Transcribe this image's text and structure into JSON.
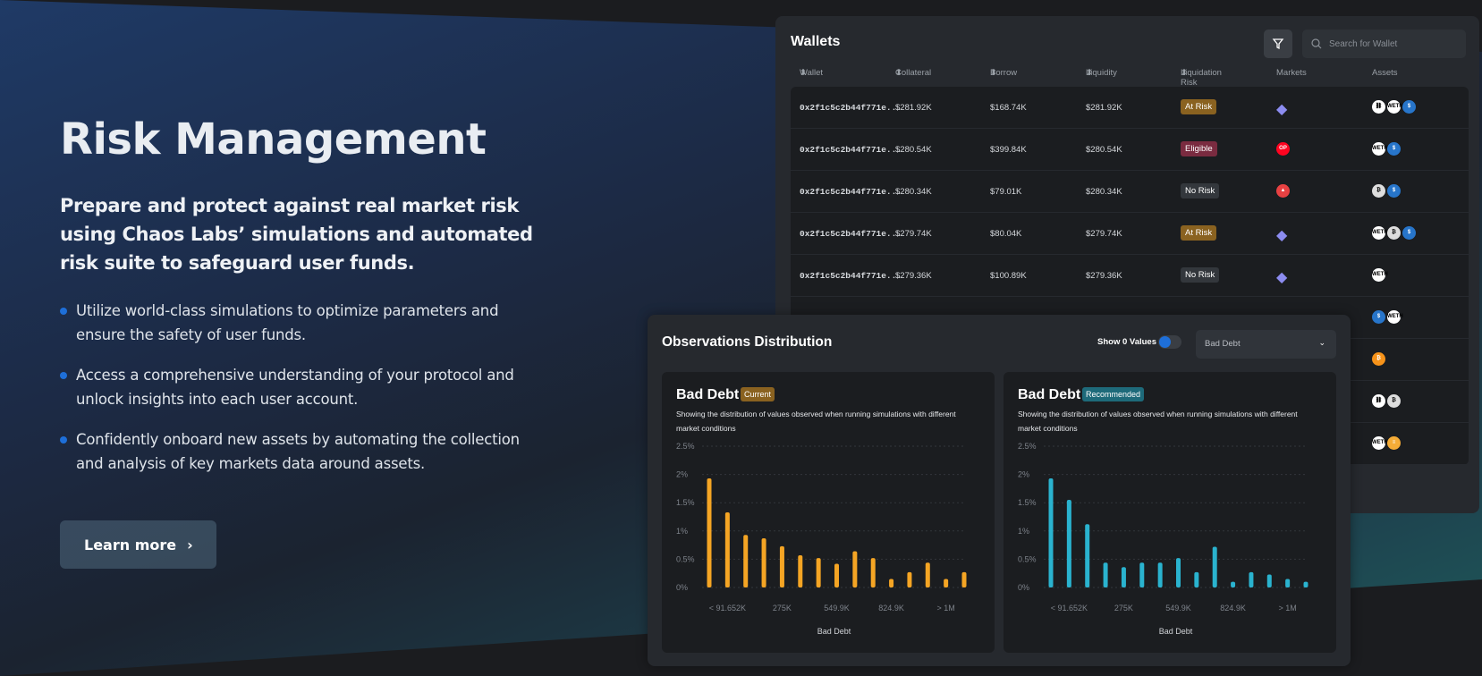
{
  "hero": {
    "title": "Risk Management",
    "lead": "Prepare and protect against real market risk using Chaos Labs’ simulations and automated risk suite to safeguard user funds.",
    "bullets": [
      "Utilize world-class simulations to optimize parameters and ensure the safety of user funds.",
      "Access a comprehensive understanding of your protocol and unlock insights into each user account.",
      "Confidently onboard new assets by automating the collection and analysis of key markets data around assets."
    ],
    "cta": "Learn more"
  },
  "wallets": {
    "title": "Wallets",
    "search_placeholder": "Search for Wallet",
    "columns": [
      "Wallet",
      "Collateral",
      "Borrow",
      "Liquidity",
      "Liquidation Risk",
      "Markets",
      "Assets"
    ],
    "rows": [
      {
        "wallet": "0x2f1c5c2b44f771e...",
        "collateral": "$281.92K",
        "borrow": "$168.74K",
        "liquidity": "$281.92K",
        "risk": "At Risk",
        "market": "ethereum",
        "assets": [
          "link",
          "weth",
          "usdc"
        ]
      },
      {
        "wallet": "0x2f1c5c2b44f771e...",
        "collateral": "$280.54K",
        "borrow": "$399.84K",
        "liquidity": "$280.54K",
        "risk": "Eligible",
        "market": "optimism",
        "assets": [
          "weth",
          "usdc"
        ]
      },
      {
        "wallet": "0x2f1c5c2b44f771e...",
        "collateral": "$280.34K",
        "borrow": "$79.01K",
        "liquidity": "$280.34K",
        "risk": "No Risk",
        "market": "avalanche",
        "assets": [
          "wbtc",
          "usdc"
        ]
      },
      {
        "wallet": "0x2f1c5c2b44f771e...",
        "collateral": "$279.74K",
        "borrow": "$80.04K",
        "liquidity": "$279.74K",
        "risk": "At Risk",
        "market": "ethereum",
        "assets": [
          "weth",
          "wbtc",
          "usdc"
        ]
      },
      {
        "wallet": "0x2f1c5c2b44f771e...",
        "collateral": "$279.36K",
        "borrow": "$100.89K",
        "liquidity": "$279.36K",
        "risk": "No Risk",
        "market": "ethereum",
        "assets": [
          "weth"
        ]
      },
      {
        "assets": [
          "usdc",
          "weth"
        ]
      },
      {
        "assets": [
          "btc"
        ]
      },
      {
        "assets": [
          "link",
          "wbtc"
        ]
      },
      {
        "assets": [
          "weth",
          "dai"
        ]
      }
    ],
    "risk_colors": {
      "At Risk": "#8a6220",
      "Eligible": "#7a2b40",
      "No Risk": "#33373c"
    }
  },
  "observations": {
    "title": "Observations Distribution",
    "toggle_label": "Show 0 Values",
    "toggle_on": true,
    "select_value": "Bad Debt"
  },
  "chart_data": [
    {
      "type": "bar",
      "title": "Bad Debt",
      "tag": "Current",
      "tag_color": "#8a6220",
      "color": "#f5a524",
      "subtitle": "Showing the distribution of values observed when running simulations with different market conditions",
      "xlabel": "Bad Debt",
      "yticks": [
        "0%",
        "0.5%",
        "1%",
        "1.5%",
        "2%",
        "2.5%"
      ],
      "ylim": [
        0,
        2.5
      ],
      "xticks": [
        "< 91.652K",
        "275K",
        "549.9K",
        "824.9K",
        "> 1M"
      ],
      "values": [
        1.93,
        1.33,
        0.93,
        0.87,
        0.73,
        0.57,
        0.52,
        0.42,
        0.64,
        0.52,
        0.15,
        0.27,
        0.44,
        0.15,
        0.27
      ]
    },
    {
      "type": "bar",
      "title": "Bad Debt",
      "tag": "Recommended",
      "tag_color": "#1e6a7a",
      "color": "#2ab3cf",
      "subtitle": "Showing the distribution of values observed when running simulations with different market conditions",
      "xlabel": "Bad Debt",
      "yticks": [
        "0%",
        "0.5%",
        "1%",
        "1.5%",
        "2%",
        "2.5%"
      ],
      "ylim": [
        0,
        2.5
      ],
      "xticks": [
        "< 91.652K",
        "275K",
        "549.9K",
        "824.9K",
        "> 1M"
      ],
      "values": [
        1.93,
        1.55,
        1.12,
        0.44,
        0.36,
        0.44,
        0.44,
        0.52,
        0.27,
        0.72,
        0.1,
        0.27,
        0.23,
        0.15,
        0.1
      ]
    }
  ]
}
